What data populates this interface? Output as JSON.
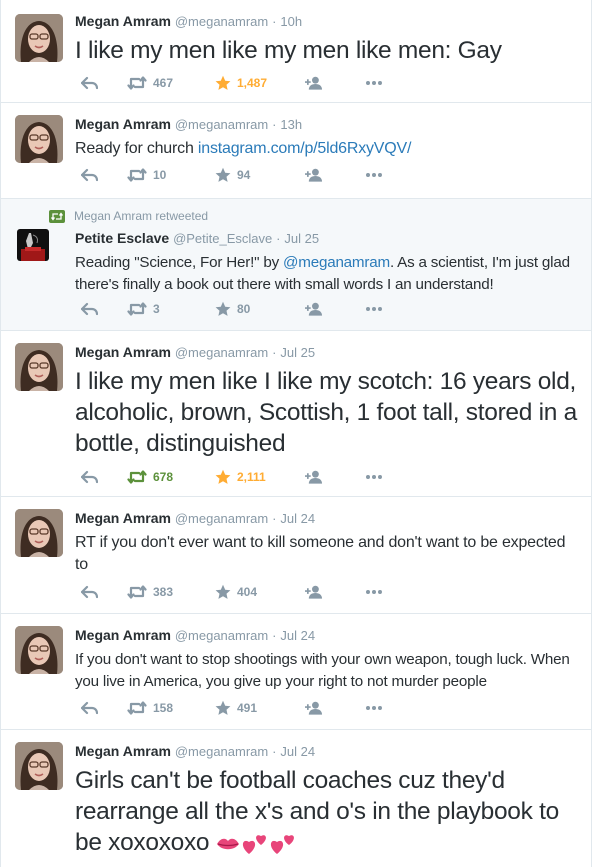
{
  "colors": {
    "text": "#292f33",
    "muted": "#8899a6",
    "link": "#2b7bb9",
    "retweet_on": "#5c913b",
    "favorite_on": "#ffac33",
    "border": "#e1e8ed",
    "highlight_bg": "#f5f8fa",
    "emoji_pink": "#e8457a"
  },
  "icons": {
    "reply": "reply-icon",
    "retweet": "retweet-icon",
    "favorite": "star-icon",
    "follow": "follow-icon",
    "more": "more-icon",
    "emoji": "kiss-icon, two-hearts-icon"
  },
  "tweets": [
    {
      "name": "Megan Amram",
      "username": "@meganamram",
      "dot": "·",
      "time": "10h",
      "text": "I like my men like my men like men: Gay",
      "retweets": "467",
      "favorites": "1,487"
    },
    {
      "name": "Megan Amram",
      "username": "@meganamram",
      "dot": "·",
      "time": "13h",
      "text": "Ready for church ",
      "link": "instagram.com/p/5ld6RxyVQV/",
      "retweets": "10",
      "favorites": "94"
    },
    {
      "retweet_context": "Megan Amram retweeted",
      "name": "Petite Esclave",
      "username": "@Petite_Esclave",
      "dot": "·",
      "time": "Jul 25",
      "text_before": "Reading \"Science, For Her!\" by ",
      "mention": "@meganamram",
      "text_after": ". As a scientist, I'm just glad there's finally a book out there with small words I an understand!",
      "retweets": "3",
      "favorites": "80"
    },
    {
      "name": "Megan Amram",
      "username": "@meganamram",
      "dot": "·",
      "time": "Jul 25",
      "text": "I like my men like I like my scotch: 16 years old, alcoholic, brown, Scottish, 1 foot tall, stored in a bottle, distinguished",
      "retweets": "678",
      "favorites": "2,111"
    },
    {
      "name": "Megan Amram",
      "username": "@meganamram",
      "dot": "·",
      "time": "Jul 24",
      "text": "RT if you don't ever want to kill someone and don't want to be expected to",
      "retweets": "383",
      "favorites": "404"
    },
    {
      "name": "Megan Amram",
      "username": "@meganamram",
      "dot": "·",
      "time": "Jul 24",
      "text": "If you don't want to stop shootings with your own weapon, tough luck. When you live in America, you give up your right to not murder people",
      "retweets": "158",
      "favorites": "491"
    },
    {
      "name": "Megan Amram",
      "username": "@meganamram",
      "dot": "·",
      "time": "Jul 24",
      "text": "Girls can't be football coaches cuz they'd rearrange all the x's and o's in the playbook to be xoxoxoxo"
    }
  ]
}
